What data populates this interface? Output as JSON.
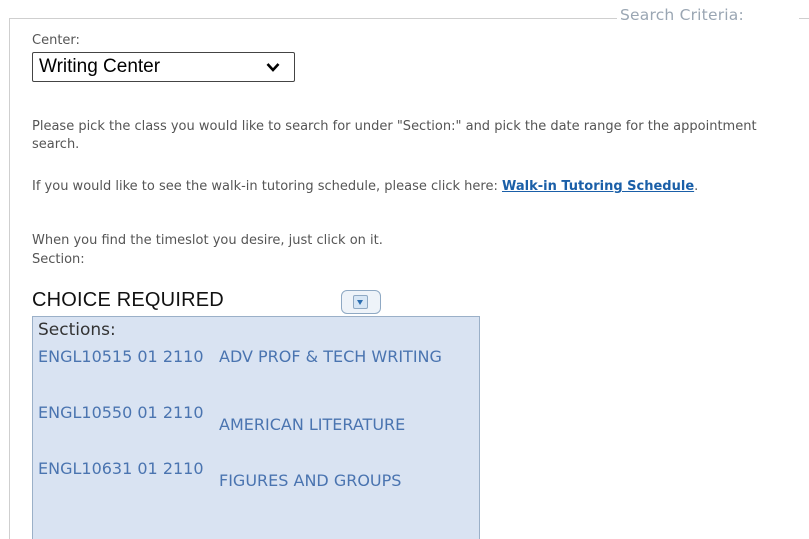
{
  "fieldset": {
    "legend": "Search Criteria:"
  },
  "center": {
    "label": "Center:",
    "selected": "Writing Center"
  },
  "instructions": {
    "pick_text": "Please pick the class you would like to search for under \"Section:\" and pick the date range for the appointment search.",
    "walkin_prefix": "If you would like to see the walk-in tutoring schedule, please click here: ",
    "walkin_link": "Walk-in Tutoring Schedule",
    "walkin_suffix": ".",
    "timeslot_text": "When you find the timeslot you desire, just click on it."
  },
  "section": {
    "label": "Section:",
    "selected": "CHOICE REQUIRED",
    "list_title": "Sections:",
    "options": [
      {
        "code": "ENGL10515 01 2110",
        "name": "ADV PROF & TECH WRITING"
      },
      {
        "code": "ENGL10550 01 2110",
        "name": "AMERICAN LITERATURE"
      },
      {
        "code": "ENGL10631 01 2110",
        "name": "FIGURES AND GROUPS"
      }
    ]
  }
}
